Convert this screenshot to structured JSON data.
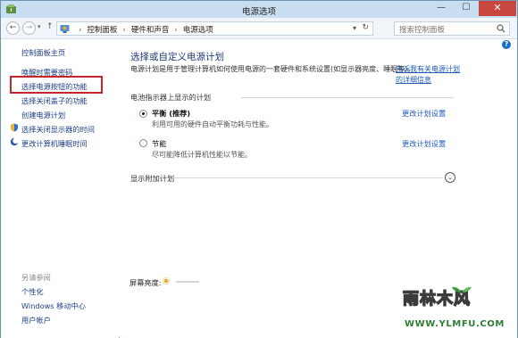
{
  "window": {
    "title": "电源选项",
    "min_glyph": "—",
    "max_glyph": "☐",
    "close_glyph": "✕"
  },
  "nav": {
    "back_glyph": "←",
    "forward_glyph": "→",
    "recent_glyph": "▾",
    "up_glyph": "↑",
    "breadcrumbs": [
      "控制面板",
      "硬件和声音",
      "电源选项"
    ],
    "breadcrumb_sep": "›",
    "dropdown_glyph": "▾",
    "refresh_glyph": "↻",
    "search_placeholder": "搜索控制面板"
  },
  "sidebar": {
    "home": "控制面板主页",
    "items": [
      "唤醒时需要密码",
      "选择电源按钮的功能",
      "选择关闭盖子的功能",
      "创建电源计划",
      "选择关闭显示器的时间",
      "更改计算机睡眠时间"
    ],
    "see_also_title": "另请参阅",
    "see_also": [
      "个性化",
      "Windows 移动中心",
      "用户帐户"
    ]
  },
  "main": {
    "help_glyph": "?",
    "heading": "选择或自定义电源计划",
    "description": "电源计划是用于管理计算机如何使用电源的一套硬件和系统设置(如显示器亮度、睡眠等)。",
    "description_link": "告诉我有关电源计划的详细信息",
    "battery_section": "电池指示器上显示的计划",
    "plans": [
      {
        "name": "平衡 (推荐)",
        "desc": "利用可用的硬件自动平衡功耗与性能。",
        "link": "更改计划设置",
        "selected": true
      },
      {
        "name": "节能",
        "desc": "尽可能降低计算机性能以节能。",
        "link": "更改计划设置",
        "selected": false
      }
    ],
    "extra_plans": "显示附加计划",
    "expand_glyph": "⌄",
    "brightness_label": "屏幕亮度:"
  },
  "watermark": {
    "text": "雨林木风",
    "url": "WWW.YLMFU.COM"
  },
  "colors": {
    "accent": "#1e3a78",
    "link": "#1e5bbf",
    "highlight_box": "#c4262e",
    "titlebar": "#c9def1",
    "close": "#c7463d"
  },
  "icons": {
    "app": "power-options-icon",
    "address": "control-panel-icon",
    "search": "magnifier-icon",
    "shield": "uac-shield-icon",
    "moon": "sleep-moon-icon",
    "brightness": "sun-icon"
  }
}
